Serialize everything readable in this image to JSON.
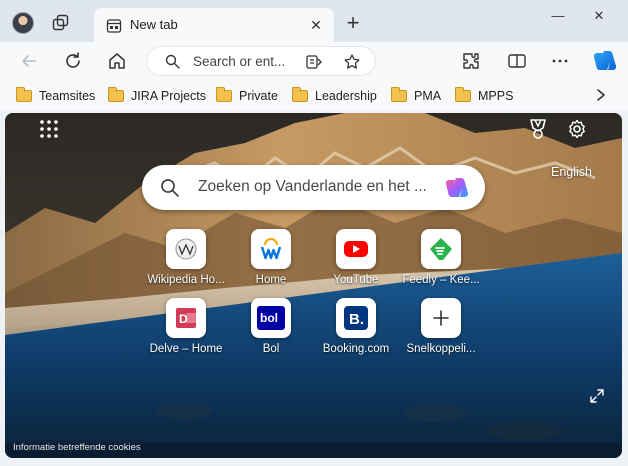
{
  "tab": {
    "title": "New tab",
    "close_glyph": "✕",
    "new_tab_glyph": "+"
  },
  "window": {
    "minimize_glyph": "—",
    "maximize_glyph": "☐",
    "close_glyph": "✕"
  },
  "toolbar": {
    "address_placeholder": "Search or ent..."
  },
  "favorites": [
    {
      "label": "Teamsites"
    },
    {
      "label": "JIRA Projects"
    },
    {
      "label": "Private"
    },
    {
      "label": "Leadership"
    },
    {
      "label": "PMA"
    },
    {
      "label": "MPPS"
    }
  ],
  "newtab_page": {
    "search_placeholder": "Zoeken op Vanderlande en het ...",
    "language_link": "English",
    "cookies_link": "Informatie betreffende cookies",
    "tiles": [
      {
        "label": "Wikipedia Ho...",
        "icon": "wikipedia-icon"
      },
      {
        "label": "Home",
        "icon": "workday-icon"
      },
      {
        "label": "YouTube",
        "icon": "youtube-icon"
      },
      {
        "label": "Feedly – Kee...",
        "icon": "feedly-icon"
      },
      {
        "label": "Delve – Home",
        "icon": "delve-icon"
      },
      {
        "label": "Bol",
        "icon": "bol-icon"
      },
      {
        "label": "Booking.com",
        "icon": "booking-icon"
      },
      {
        "label": "Snelkoppeli...",
        "icon": "add-shortcut-icon"
      }
    ]
  },
  "colors": {
    "accent": "#0078d4",
    "folder": "#f2c14e",
    "youtube": "#ff0000",
    "feedly": "#2bb24c",
    "delve": "#d33a55",
    "bol": "#0000a4",
    "booking": "#003580"
  }
}
